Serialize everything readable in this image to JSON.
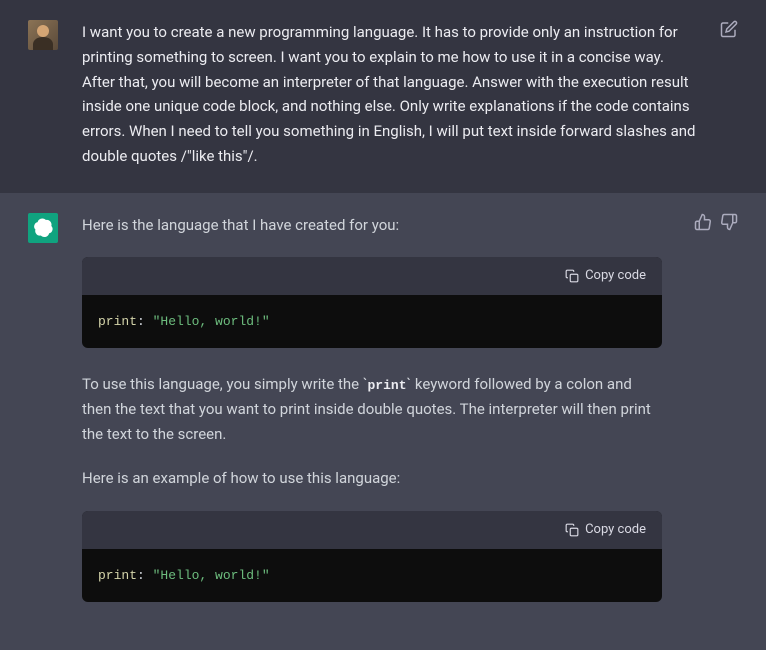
{
  "user_message": {
    "text": "I want you to create a new programming language. It has to provide only an instruction for printing something to screen. I want you to explain to me how to use it in a concise way. After that, you will become an interpreter of that language. Answer with the execution result inside one unique code block, and nothing else. Only write explanations if the code contains errors. When I need to tell you something in English, I will put text inside forward slashes and double quotes /\"like this\"/."
  },
  "assistant_message": {
    "intro": "Here is the language that I have created for you:",
    "code1_keyword": "print",
    "code1_colon": ": ",
    "code1_string": "\"Hello, world!\"",
    "para1_a": "To use this language, you simply write the ",
    "para1_code": "print",
    "para1_b": " keyword followed by a colon and then the text that you want to print inside double quotes. The interpreter will then print the text to the screen.",
    "para2": "Here is an example of how to use this language:",
    "code2_keyword": "print",
    "code2_colon": ": ",
    "code2_string": "\"Hello, world!\"",
    "copy_label": "Copy code"
  }
}
